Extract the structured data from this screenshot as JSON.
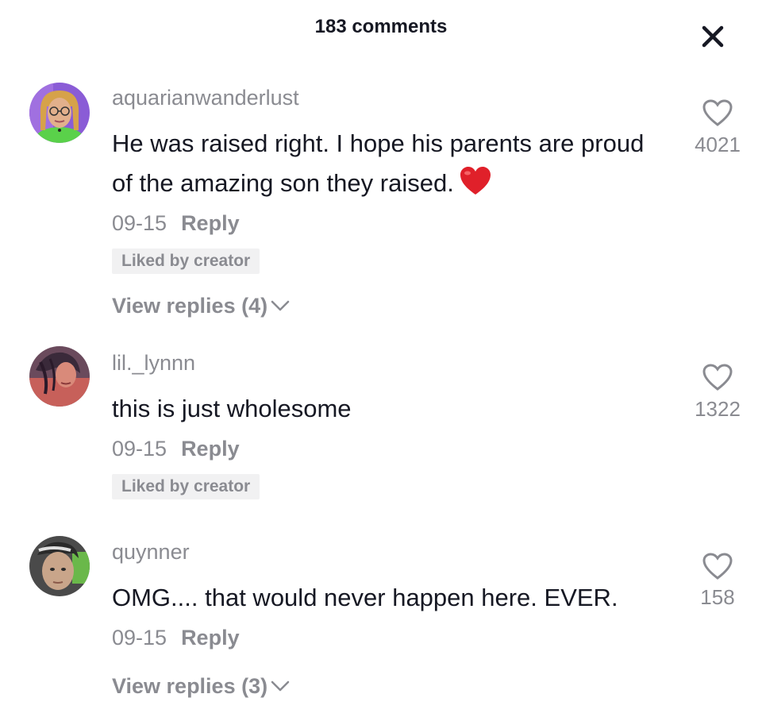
{
  "header": {
    "title": "183 comments",
    "close_icon": "close-icon"
  },
  "comments": [
    {
      "username": "aquarianwanderlust",
      "text": "He was raised right. I hope his parents are proud of the amazing son they raised.",
      "emoji": "red-heart-emoji",
      "date": "09-15",
      "reply_label": "Reply",
      "liked_by_creator": "Liked by creator",
      "view_replies": "View replies (4)",
      "likes": "4021",
      "avatar_colors": {
        "bg": "#8a5cd6",
        "skin": "#e2b08c",
        "hair": "#d6a24a",
        "shirt": "#5ad14a"
      }
    },
    {
      "username": "lil._lynnn",
      "text": "this is just wholesome",
      "date": "09-15",
      "reply_label": "Reply",
      "liked_by_creator": "Liked by creator",
      "likes": "1322",
      "avatar_colors": {
        "bg": "#6a4a5c",
        "skin": "#d98a7a",
        "hair": "#3a2a3a",
        "shirt": "#c7605a"
      }
    },
    {
      "username": "quynner",
      "text": "OMG.... that would never happen here. EVER.",
      "date": "09-15",
      "reply_label": "Reply",
      "view_replies": "View replies (3)",
      "likes": "158",
      "avatar_colors": {
        "bg": "#4a4a4a",
        "skin": "#c9a58a",
        "hair": "#2a2a2a",
        "shirt": "#6ab84a"
      }
    }
  ],
  "colors": {
    "primary_text": "#161823",
    "secondary_text": "#8a8b91",
    "badge_bg": "#f1f1f2",
    "heart_red": "#e0202a"
  }
}
